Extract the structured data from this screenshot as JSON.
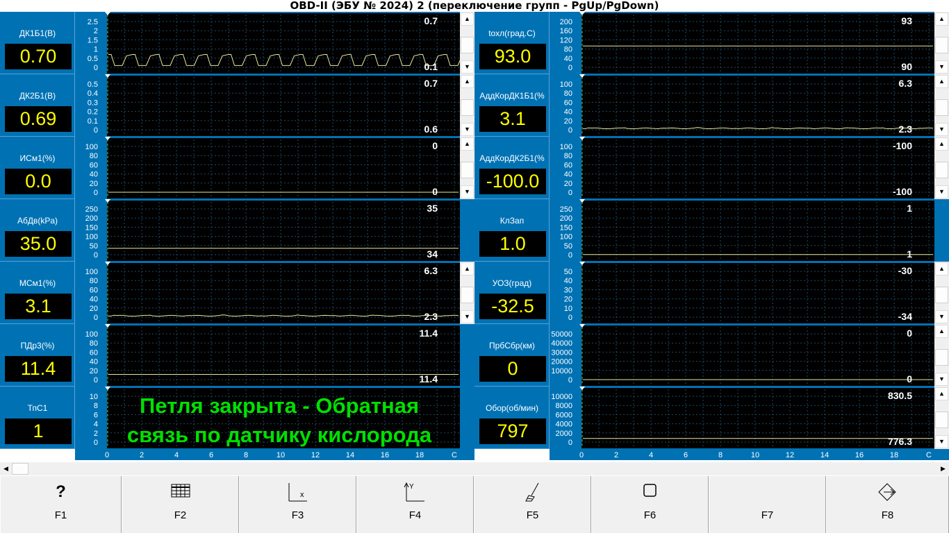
{
  "window_title": "OBD-II (ЭБУ № 2024) 2 (переключение групп - PgUp/PgDown)",
  "x_axis_ticks": [
    "0",
    "2",
    "4",
    "6",
    "8",
    "10",
    "12",
    "14",
    "16",
    "18",
    "С"
  ],
  "status_message": [
    "Петля закрыта - Обратная",
    "связь по датчику кислорода"
  ],
  "colors": {
    "panel_blue": "#0072b4",
    "plot_bg": "#000000",
    "grid": "#1f4a66",
    "trace": "#e8e8a0",
    "value": "#ffff00",
    "status_green": "#00e000"
  },
  "panels": [
    {
      "id": "dk1b1",
      "name": "ДК1Б1(В)",
      "value": "0.70",
      "yticks": [
        "2.5",
        "2",
        "1.5",
        "1",
        "0.5",
        "0"
      ],
      "max": "0.7",
      "min": "0.1",
      "ymin": 0,
      "ymax": 2.5,
      "trace": "wave",
      "level": 0.7,
      "scroll": "thumb"
    },
    {
      "id": "toxl",
      "name": "tохл(град.С)",
      "value": "93.0",
      "yticks": [
        "200",
        "160",
        "120",
        "80",
        "40",
        "0"
      ],
      "max": "93",
      "min": "90",
      "ymin": 0,
      "ymax": 200,
      "trace": "flat",
      "level": 93,
      "scroll": "thumb"
    },
    {
      "id": "dk2b1",
      "name": "ДК2Б1(В)",
      "value": "0.69",
      "yticks": [
        "0.5",
        "0.4",
        "0.3",
        "0.2",
        "0.1",
        "0"
      ],
      "max": "0.7",
      "min": "0.6",
      "ymin": 0,
      "ymax": 0.5,
      "trace": "none",
      "level": 0.69,
      "scroll": "thumb"
    },
    {
      "id": "addk1",
      "name": "АддКорДК1Б1(%",
      "value": "3.1",
      "yticks": [
        "100",
        "80",
        "60",
        "40",
        "20",
        "0"
      ],
      "max": "6.3",
      "min": "2.3",
      "ymin": 0,
      "ymax": 100,
      "trace": "noisy",
      "level": 3.1,
      "scroll": "thumb"
    },
    {
      "id": "ism1",
      "name": "ИСм1(%)",
      "value": "0.0",
      "yticks": [
        "100",
        "80",
        "60",
        "40",
        "20",
        "0"
      ],
      "max": "0",
      "min": "0",
      "ymin": 0,
      "ymax": 100,
      "trace": "flat",
      "level": 0,
      "scroll": "thumb"
    },
    {
      "id": "addk2",
      "name": "АддКорДК2Б1(%",
      "value": "-100.0",
      "yticks": [
        "100",
        "80",
        "60",
        "40",
        "20",
        "0"
      ],
      "max": "-100",
      "min": "-100",
      "ymin": 0,
      "ymax": 100,
      "trace": "none",
      "level": -100,
      "scroll": "thumb"
    },
    {
      "id": "abdv",
      "name": "АбДв(kPa)",
      "value": "35.0",
      "yticks": [
        "250",
        "200",
        "150",
        "100",
        "50",
        "0"
      ],
      "max": "35",
      "min": "34",
      "ymin": 0,
      "ymax": 250,
      "trace": "flat",
      "level": 35,
      "scroll": "none"
    },
    {
      "id": "klzap",
      "name": "КлЗап",
      "value": "1.0",
      "yticks": [
        "250",
        "200",
        "150",
        "100",
        "50",
        "0"
      ],
      "max": "1",
      "min": "1",
      "ymin": 0,
      "ymax": 250,
      "trace": "flat",
      "level": 1,
      "scroll": "blue"
    },
    {
      "id": "msm1",
      "name": "МСм1(%)",
      "value": "3.1",
      "yticks": [
        "100",
        "80",
        "60",
        "40",
        "20",
        "0"
      ],
      "max": "6.3",
      "min": "2.3",
      "ymin": 0,
      "ymax": 100,
      "trace": "noisy",
      "level": 3.1,
      "scroll": "thumb"
    },
    {
      "id": "uoz",
      "name": "УОЗ(град)",
      "value": "-32.5",
      "yticks": [
        "50",
        "40",
        "30",
        "20",
        "10",
        "0"
      ],
      "max": "-30",
      "min": "-34",
      "ymin": 0,
      "ymax": 50,
      "trace": "none",
      "level": -32.5,
      "scroll": "thumb"
    },
    {
      "id": "pdr3",
      "name": "ПДр3(%)",
      "value": "11.4",
      "yticks": [
        "100",
        "80",
        "60",
        "40",
        "20",
        "0"
      ],
      "max": "11.4",
      "min": "11.4",
      "ymin": 0,
      "ymax": 100,
      "trace": "flat",
      "level": 11.4,
      "scroll": "none"
    },
    {
      "id": "prbsbr",
      "name": "ПрбСбр(км)",
      "value": "0",
      "yticks": [
        "50000",
        "40000",
        "30000",
        "20000",
        "10000",
        "0"
      ],
      "max": "0",
      "min": "0",
      "ymin": 0,
      "ymax": 50000,
      "trace": "flat",
      "level": 0,
      "scroll": "thumb"
    },
    {
      "id": "tps1",
      "name": "ТпС1",
      "value": "1",
      "yticks": [
        "10",
        "8",
        "6",
        "4",
        "2",
        "0"
      ],
      "max": "",
      "min": "",
      "ymin": 0,
      "ymax": 10,
      "trace": "none",
      "level": 1,
      "scroll": "none",
      "status": true
    },
    {
      "id": "obor",
      "name": "Обор(об/мин)",
      "value": "797",
      "yticks": [
        "10000",
        "8000",
        "6000",
        "4000",
        "2000",
        "0"
      ],
      "max": "830.5",
      "min": "776.3",
      "ymin": 0,
      "ymax": 10000,
      "trace": "flat",
      "level": 797,
      "scroll": "thumb"
    }
  ],
  "fkeys": [
    {
      "label": "F1",
      "icon": "help-icon",
      "glyph": "?"
    },
    {
      "label": "F2",
      "icon": "table-icon"
    },
    {
      "label": "F3",
      "icon": "x-axis-icon"
    },
    {
      "label": "F4",
      "icon": "y-axis-icon"
    },
    {
      "label": "F5",
      "icon": "brush-icon"
    },
    {
      "label": "F6",
      "icon": "square-icon"
    },
    {
      "label": "F7",
      "icon": "none"
    },
    {
      "label": "F8",
      "icon": "exit-icon"
    }
  ]
}
